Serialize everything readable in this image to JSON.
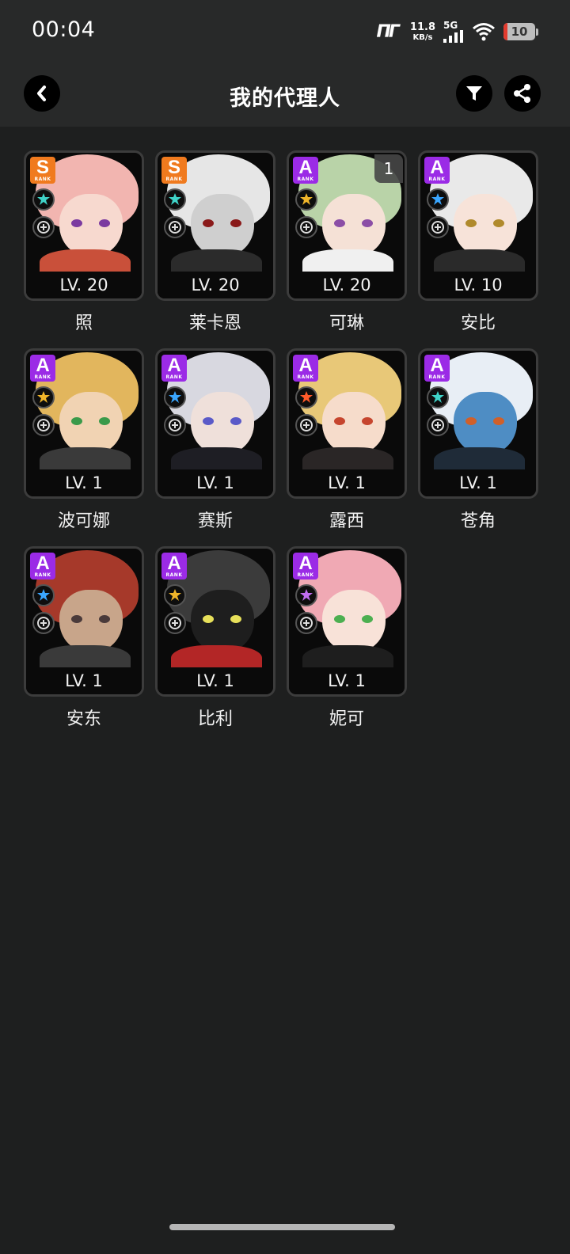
{
  "status_bar": {
    "time": "00:04",
    "net_speed_value": "11.8",
    "net_speed_unit": "KB/s",
    "network_type": "5G",
    "battery_level": "10"
  },
  "app_bar": {
    "title": "我的代理人",
    "back_icon": "chevron-left-icon",
    "filter_icon": "filter-icon",
    "share_icon": "share-icon"
  },
  "agents": [
    {
      "name": "照",
      "level": "LV. 20",
      "rank": "S",
      "element": "ether",
      "specialty": "defense",
      "hair": "#f2b5b0",
      "face": "#f7d9cf",
      "eye": "#7b3aa0",
      "body": "#c9503a"
    },
    {
      "name": "莱卡恩",
      "level": "LV. 20",
      "rank": "S",
      "element": "ether",
      "specialty": "stun",
      "hair": "#e6e6e6",
      "face": "#cfcfcf",
      "eye": "#8a1a1a",
      "body": "#2b2b2b"
    },
    {
      "name": "可琳",
      "level": "LV. 20",
      "rank": "A",
      "element": "physical",
      "specialty": "attack",
      "hair": "#b9d3a8",
      "face": "#f5e1d6",
      "eye": "#8b4ea6",
      "body": "#f0f0f0",
      "count": "1"
    },
    {
      "name": "安比",
      "level": "LV. 10",
      "rank": "A",
      "element": "electric",
      "specialty": "stun",
      "hair": "#e9e9e9",
      "face": "#f7e3d9",
      "eye": "#b08a2c",
      "body": "#2a2a2a"
    },
    {
      "name": "波可娜",
      "level": "LV. 1",
      "rank": "A",
      "element": "physical",
      "specialty": "stun",
      "hair": "#e2b65d",
      "face": "#f1d3b3",
      "eye": "#3a9a4a",
      "body": "#3a3a3a"
    },
    {
      "name": "赛斯",
      "level": "LV. 1",
      "rank": "A",
      "element": "electric",
      "specialty": "defense",
      "hair": "#d8d8e0",
      "face": "#efe0da",
      "eye": "#5a5ac8",
      "body": "#1e1e24"
    },
    {
      "name": "露西",
      "level": "LV. 1",
      "rank": "A",
      "element": "fire",
      "specialty": "support",
      "hair": "#e8c878",
      "face": "#f6dccb",
      "eye": "#c6452e",
      "body": "#2a2626"
    },
    {
      "name": "苍角",
      "level": "LV. 1",
      "rank": "A",
      "element": "ether",
      "specialty": "support",
      "hair": "#e8eef5",
      "face": "#4e8dc4",
      "eye": "#d0602a",
      "body": "#1f2b38"
    },
    {
      "name": "安东",
      "level": "LV. 1",
      "rank": "A",
      "element": "electric",
      "specialty": "attack",
      "hair": "#a6392a",
      "face": "#c8a58a",
      "eye": "#4a3a3a",
      "body": "#3a3a3a"
    },
    {
      "name": "比利",
      "level": "LV. 1",
      "rank": "A",
      "element": "physical",
      "specialty": "attack",
      "hair": "#3b3b3b",
      "face": "#1e1e1e",
      "eye": "#e7e05a",
      "body": "#b32626"
    },
    {
      "name": "妮可",
      "level": "LV. 1",
      "rank": "A",
      "element": "ether-purple",
      "specialty": "support",
      "hair": "#f0a9b4",
      "face": "#f8e2d8",
      "eye": "#4caf50",
      "body": "#1e1e1e"
    }
  ],
  "element_colors": {
    "ether": "#3fd3c8",
    "physical": "#f0b52a",
    "electric": "#3aa6ff",
    "fire": "#ff5a2a",
    "ether-purple": "#c06ef0"
  }
}
